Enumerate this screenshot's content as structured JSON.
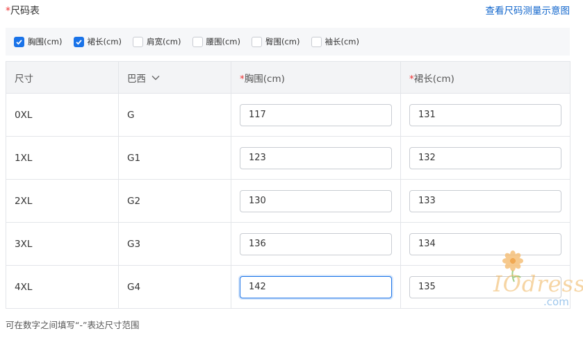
{
  "header": {
    "required_mark": "*",
    "title": "尺码表",
    "link": "查看尺码测量示意图"
  },
  "filters": [
    {
      "label": "胸围(cm)",
      "checked": true
    },
    {
      "label": "裙长(cm)",
      "checked": true
    },
    {
      "label": "肩宽(cm)",
      "checked": false
    },
    {
      "label": "腰围(cm)",
      "checked": false
    },
    {
      "label": "臀围(cm)",
      "checked": false
    },
    {
      "label": "袖长(cm)",
      "checked": false
    }
  ],
  "table": {
    "columns": {
      "size": "尺寸",
      "brazil": "巴西",
      "bust_mark": "*",
      "bust": "胸围(cm)",
      "length_mark": "*",
      "length": "裙长(cm)"
    },
    "rows": [
      {
        "size": "0XL",
        "br": "G",
        "bust": "117",
        "length": "131"
      },
      {
        "size": "1XL",
        "br": "G1",
        "bust": "123",
        "length": "132"
      },
      {
        "size": "2XL",
        "br": "G2",
        "bust": "130",
        "length": "133"
      },
      {
        "size": "3XL",
        "br": "G3",
        "bust": "136",
        "length": "134"
      },
      {
        "size": "4XL",
        "br": "G4",
        "bust": "142",
        "length": "135"
      }
    ]
  },
  "hint": "可在数字之间填写“-”表达尺寸范围",
  "watermark": {
    "brand": "IOdress",
    "domain": ".com"
  },
  "colors": {
    "accent": "#1a73e8",
    "link": "#1166cc",
    "required": "#ee3333"
  }
}
